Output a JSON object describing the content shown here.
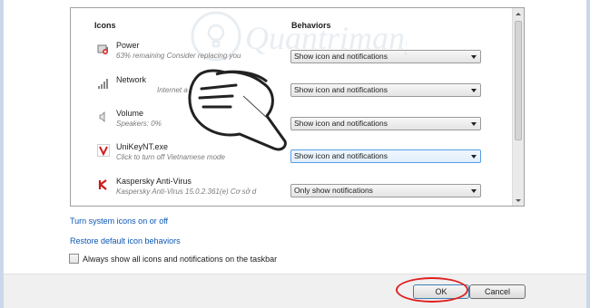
{
  "columns": {
    "icons": "Icons",
    "behaviors": "Behaviors"
  },
  "items": [
    {
      "name": "Power",
      "desc": "63% remaining  Consider replacing you",
      "behavior": "Show icon and notifications",
      "icon": "battery-warning-icon"
    },
    {
      "name": "Network",
      "desc": "Internet a",
      "behavior": "Show icon and notifications",
      "icon": "network-signal-icon"
    },
    {
      "name": "Volume",
      "desc": "Speakers: 0%",
      "behavior": "Show icon and notifications",
      "icon": "speaker-icon"
    },
    {
      "name": "UniKeyNT.exe",
      "desc": "Click to turn off Vietnamese mode",
      "behavior": "Show icon and notifications",
      "icon": "unikey-v-icon"
    },
    {
      "name": "Kaspersky Anti-Virus",
      "desc": "Kaspersky Anti-Virus 15.0.2.361(e) Cơ sở d",
      "behavior": "Only show notifications",
      "icon": "kaspersky-k-icon"
    }
  ],
  "links": {
    "system_icons": "Turn system icons on or off",
    "restore": "Restore default icon behaviors"
  },
  "always_show": {
    "label": "Always show all icons and notifications on the taskbar",
    "checked": false
  },
  "buttons": {
    "ok": "OK",
    "cancel": "Cancel"
  },
  "watermark": {
    "text": "Quantrimang"
  },
  "colors": {
    "link": "#0b56b3",
    "highlight": "#e02020",
    "footer": "#f0f0f0"
  }
}
